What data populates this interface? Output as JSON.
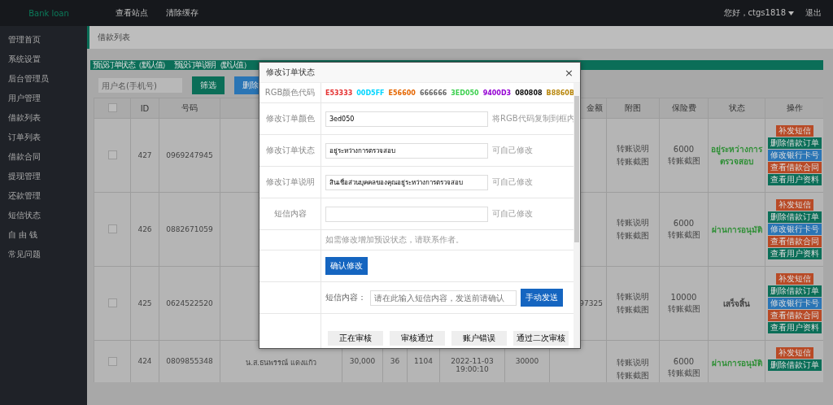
{
  "topbar": {
    "logo": "Bank loan",
    "nav": [
      "查看站点",
      "清除缓存"
    ],
    "user": "您好，ctgs1818",
    "logout": "退出"
  },
  "sidebar": {
    "items": [
      "管理首页",
      "系统设置",
      "后台管理员",
      "用户管理",
      "借款列表",
      "订单列表",
      "借款合同",
      "提现管理",
      "还款管理",
      "短信状态",
      "自 由 钱",
      "常见问题"
    ]
  },
  "breadcrumb": "借款列表",
  "preset_bar": [
    "预设订单状态（默认值）",
    "预设订单说明（默认值）"
  ],
  "filter": {
    "placeholder": "用户名(手机号)",
    "buttons": [
      {
        "label": "筛选",
        "kind": "filter"
      },
      {
        "label": "删除",
        "kind": "delete"
      }
    ]
  },
  "table": {
    "select_all": {
      "checked": false
    },
    "columns": {
      "id": "ID",
      "phone": "号码",
      "repay": "金额",
      "attachment": "附图",
      "insurance": "保险费",
      "status": "状态",
      "actions": "操作"
    },
    "rows": [
      {
        "checked": false,
        "id": "427",
        "phone": "0969247945",
        "attachment": [
          "转账说明",
          "转账截图"
        ],
        "insurance": [
          "6000",
          "转账截图"
        ],
        "status": "อยู่ระหว่างการตรวจสอบ",
        "color": "#2f8f36",
        "actions": [
          {
            "label": "补发短信",
            "kind": "sms"
          },
          {
            "label": "删除借款订单",
            "kind": "delete"
          },
          {
            "label": "修改银行卡号",
            "kind": "bank"
          },
          {
            "label": "查看借款合同",
            "kind": "contract"
          },
          {
            "label": "查看用户资料",
            "kind": "profile"
          }
        ]
      },
      {
        "checked": false,
        "id": "426",
        "phone": "0882671059",
        "attachment": [
          "转账说明",
          "转账截图"
        ],
        "insurance": [
          "6000",
          "转账截图"
        ],
        "status": "ผ่านการอนุมัติ",
        "color": "#2f8f36",
        "actions": [
          {
            "label": "补发短信",
            "kind": "sms"
          },
          {
            "label": "删除借款订单",
            "kind": "delete"
          },
          {
            "label": "修改银行卡号",
            "kind": "bank"
          },
          {
            "label": "查看借款合同",
            "kind": "contract"
          },
          {
            "label": "查看用户资料",
            "kind": "profile"
          }
        ]
      },
      {
        "checked": false,
        "id": "425",
        "phone": "0624522520",
        "repay": "97325",
        "attachment": [
          "转账说明",
          "转账截图"
        ],
        "insurance": [
          "10000",
          "转账截图"
        ],
        "status": "เสร็จสิ้น",
        "color": "#444444",
        "actions": [
          {
            "label": "补发短信",
            "kind": "sms"
          },
          {
            "label": "删除借款订单",
            "kind": "delete"
          },
          {
            "label": "修改银行卡号",
            "kind": "bank"
          },
          {
            "label": "查看借款合同",
            "kind": "contract"
          },
          {
            "label": "查看用户资料",
            "kind": "profile"
          }
        ]
      },
      {
        "checked": false,
        "id": "424",
        "phone": "0809855348",
        "name": "น.ส.ธนพรรณ์ แดงแก้ว",
        "amount": "30,000",
        "term": "36",
        "code": "1104",
        "time": "2022-11-03 19:00:10",
        "total": "30000",
        "attachment": [
          "转账说明",
          "转账截图"
        ],
        "insurance": [
          "6000",
          "转账截图"
        ],
        "status": "ผ่านการอนุมัติ",
        "color": "#2f8f36",
        "actions": [
          {
            "label": "补发短信",
            "kind": "sms"
          },
          {
            "label": "删除借款订单",
            "kind": "delete"
          }
        ]
      }
    ]
  },
  "modal": {
    "title": "修改订单状态",
    "close": "×",
    "palette_label": "RGB颜色代码",
    "palette": [
      {
        "code": "E53333",
        "color": "#e53333"
      },
      {
        "code": "00D5FF",
        "color": "#00d5ff"
      },
      {
        "code": "E56600",
        "color": "#e56600"
      },
      {
        "code": "666666",
        "color": "#666666"
      },
      {
        "code": "3ED050",
        "color": "#3ed050"
      },
      {
        "code": "9400D3",
        "color": "#9400d3"
      },
      {
        "code": "080808",
        "color": "#080808"
      },
      {
        "code": "B8860B",
        "color": "#b8860b"
      }
    ],
    "fields": [
      {
        "label": "修改订单颜色",
        "value": "3ed050",
        "hint": "将RGB代码复制到框内"
      },
      {
        "label": "修改订单状态",
        "value": "อยู่ระหว่างการตรวจสอบ",
        "hint": "可自己修改"
      },
      {
        "label": "修改订单说明",
        "value": "สินเชื่อส่วนบุคคลของคุณอยู่ระหว่างการตรวจสอบ",
        "hint": "可自己修改"
      },
      {
        "label": "短信内容",
        "hint": "可自己修改"
      }
    ],
    "note": "如需修改增加预设状态，请联系作者。",
    "confirm": "确认修改",
    "sms_label": "短信内容：",
    "sms_placeholder": "请在此输入短信内容，发送前请确认",
    "send": "手动发送",
    "status_buttons": [
      "正在审核",
      "审核通过",
      "账户错误",
      "通过二次审核"
    ]
  }
}
